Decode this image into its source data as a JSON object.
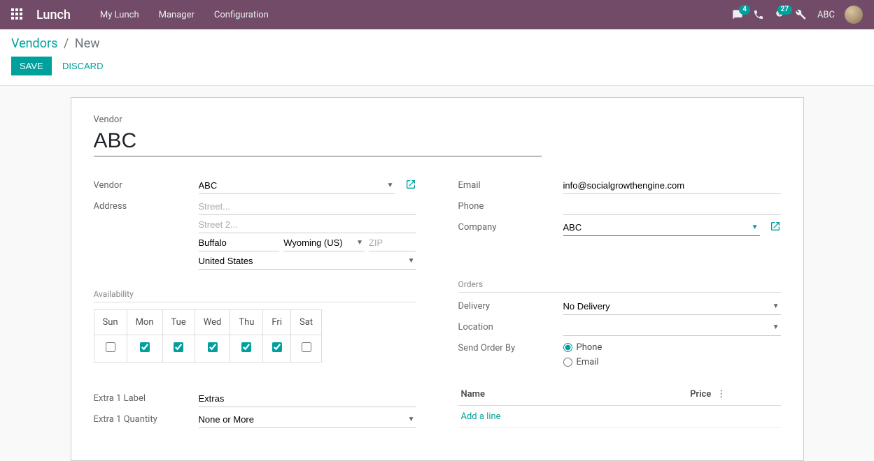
{
  "navbar": {
    "brand": "Lunch",
    "menu": [
      "My Lunch",
      "Manager",
      "Configuration"
    ],
    "messages_badge": "4",
    "activities_badge": "27",
    "username": "ABC"
  },
  "breadcrumb": {
    "parent": "Vendors",
    "current": "New"
  },
  "actions": {
    "save": "SAVE",
    "discard": "DISCARD"
  },
  "form": {
    "vendor_section_label": "Vendor",
    "title": "ABC",
    "left": {
      "vendor_label": "Vendor",
      "vendor_value": "ABC",
      "address_label": "Address",
      "street_ph": "Street...",
      "street2_ph": "Street 2...",
      "city": "Buffalo",
      "state": "Wyoming (US)",
      "zip_ph": "ZIP",
      "country": "United States",
      "availability_label": "Availability",
      "days": [
        "Sun",
        "Mon",
        "Tue",
        "Wed",
        "Thu",
        "Fri",
        "Sat"
      ],
      "days_checked": [
        false,
        true,
        true,
        true,
        true,
        true,
        false
      ],
      "extra1_label_lbl": "Extra 1 Label",
      "extra1_label_val": "Extras",
      "extra1_qty_lbl": "Extra 1 Quantity",
      "extra1_qty_val": "None or More"
    },
    "right": {
      "email_label": "Email",
      "email_value": "info@socialgrowthengine.com",
      "phone_label": "Phone",
      "phone_value": "",
      "company_label": "Company",
      "company_value": "ABC",
      "orders_section": "Orders",
      "delivery_label": "Delivery",
      "delivery_value": "No Delivery",
      "location_label": "Location",
      "location_value": "",
      "send_order_by_label": "Send Order By",
      "send_opt_phone": "Phone",
      "send_opt_email": "Email",
      "table_name": "Name",
      "table_price": "Price",
      "add_line": "Add a line"
    }
  }
}
